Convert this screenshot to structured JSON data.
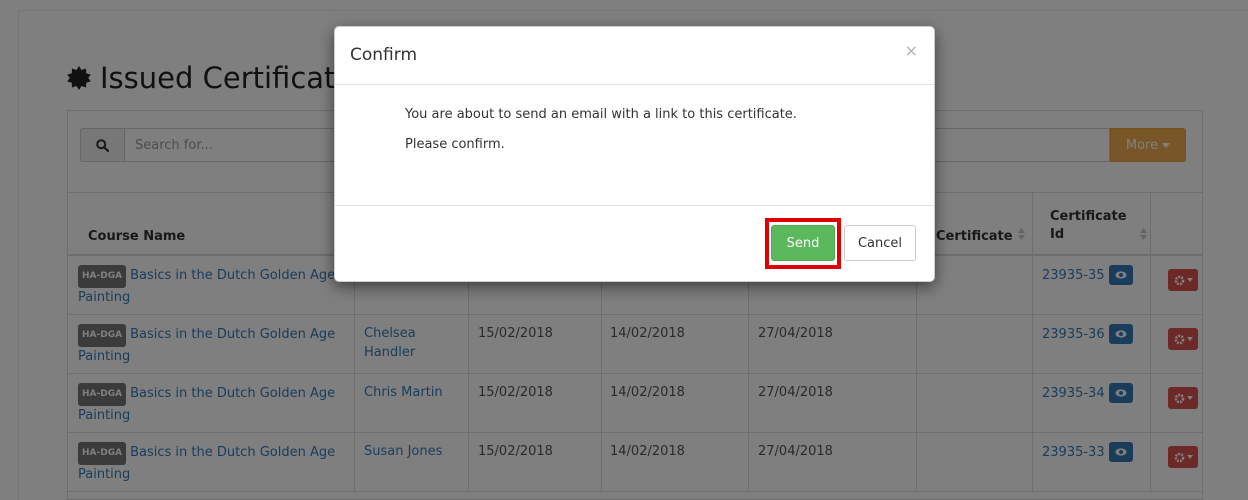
{
  "page": {
    "heading": "Issued Certificates",
    "heading_icon": "certificate-badge-icon"
  },
  "search": {
    "placeholder": "Search for...",
    "icon": "search-icon",
    "more_label": "More"
  },
  "table": {
    "columns": [
      {
        "label": "Course Name"
      },
      {
        "label": "Certificate"
      },
      {
        "label": "Certificate Id"
      }
    ],
    "rows": [
      {
        "tag": "HA-DGA",
        "course": "Basics in the Dutch Golden Age Painting",
        "student": "",
        "date1": "",
        "date2": "",
        "date3": "",
        "cert_id": "23935-35"
      },
      {
        "tag": "HA-DGA",
        "course": "Basics in the Dutch Golden Age Painting",
        "student": "Chelsea Handler",
        "date1": "15/02/2018",
        "date2": "14/02/2018",
        "date3": "27/04/2018",
        "cert_id": "23935-36"
      },
      {
        "tag": "HA-DGA",
        "course": "Basics in the Dutch Golden Age Painting",
        "student": "Chris Martin",
        "date1": "15/02/2018",
        "date2": "14/02/2018",
        "date3": "27/04/2018",
        "cert_id": "23935-34"
      },
      {
        "tag": "HA-DGA",
        "course": "Basics in the Dutch Golden Age Painting",
        "student": "Susan Jones",
        "date1": "15/02/2018",
        "date2": "14/02/2018",
        "date3": "27/04/2018",
        "cert_id": "23935-33"
      }
    ]
  },
  "modal": {
    "title": "Confirm",
    "close_symbol": "×",
    "message": "You are about to send an email with a link to this certificate.",
    "confirm_prompt": "Please confirm.",
    "send_label": "Send",
    "cancel_label": "Cancel"
  },
  "colors": {
    "link": "#337ab7",
    "send": "#5cb85c",
    "more": "#f0ad4e",
    "action": "#d9534f",
    "highlight": "#e00000"
  }
}
